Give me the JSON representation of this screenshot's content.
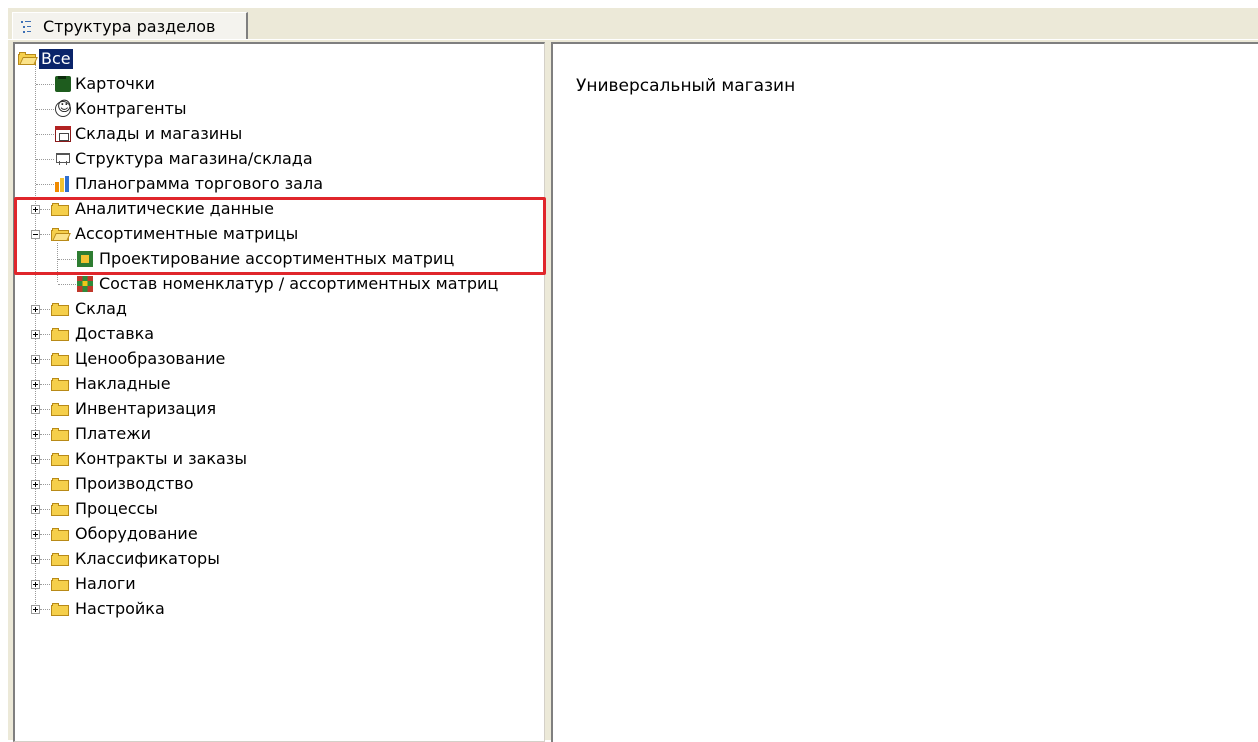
{
  "tab": {
    "label": "Структура разделов"
  },
  "tree": {
    "root": {
      "label": "Все"
    },
    "top_items": [
      {
        "label": "Карточки",
        "icon": "cards-icon"
      },
      {
        "label": "Контрагенты",
        "icon": "counterparty-icon"
      },
      {
        "label": "Склады и магазины",
        "icon": "store-icon"
      },
      {
        "label": "Структура магазина/склада",
        "icon": "structure-icon"
      },
      {
        "label": "Планограмма торгового зала",
        "icon": "planogram-icon"
      }
    ],
    "analytics": {
      "label": "Аналитические данные"
    },
    "assortment": {
      "label": "Ассортиментные матрицы",
      "children": [
        {
          "label": "Проектирование ассортиментных матриц",
          "icon": "matrix-design-icon"
        },
        {
          "label": "Состав номенклатур / ассортиментных матриц",
          "icon": "matrix-composition-icon"
        }
      ]
    },
    "folders": [
      {
        "label": "Склад"
      },
      {
        "label": "Доставка"
      },
      {
        "label": "Ценообразование"
      },
      {
        "label": "Накладные"
      },
      {
        "label": "Инвентаризация"
      },
      {
        "label": "Платежи"
      },
      {
        "label": "Контракты и заказы"
      },
      {
        "label": "Производство"
      },
      {
        "label": "Процессы"
      },
      {
        "label": "Оборудование"
      },
      {
        "label": "Классификаторы"
      },
      {
        "label": "Налоги"
      },
      {
        "label": "Настройка"
      }
    ]
  },
  "detail": {
    "title": "Универсальный магазин"
  },
  "colors": {
    "selection": "#0a246a",
    "highlight": "#e0262b",
    "folder": "#f5cf4b"
  }
}
